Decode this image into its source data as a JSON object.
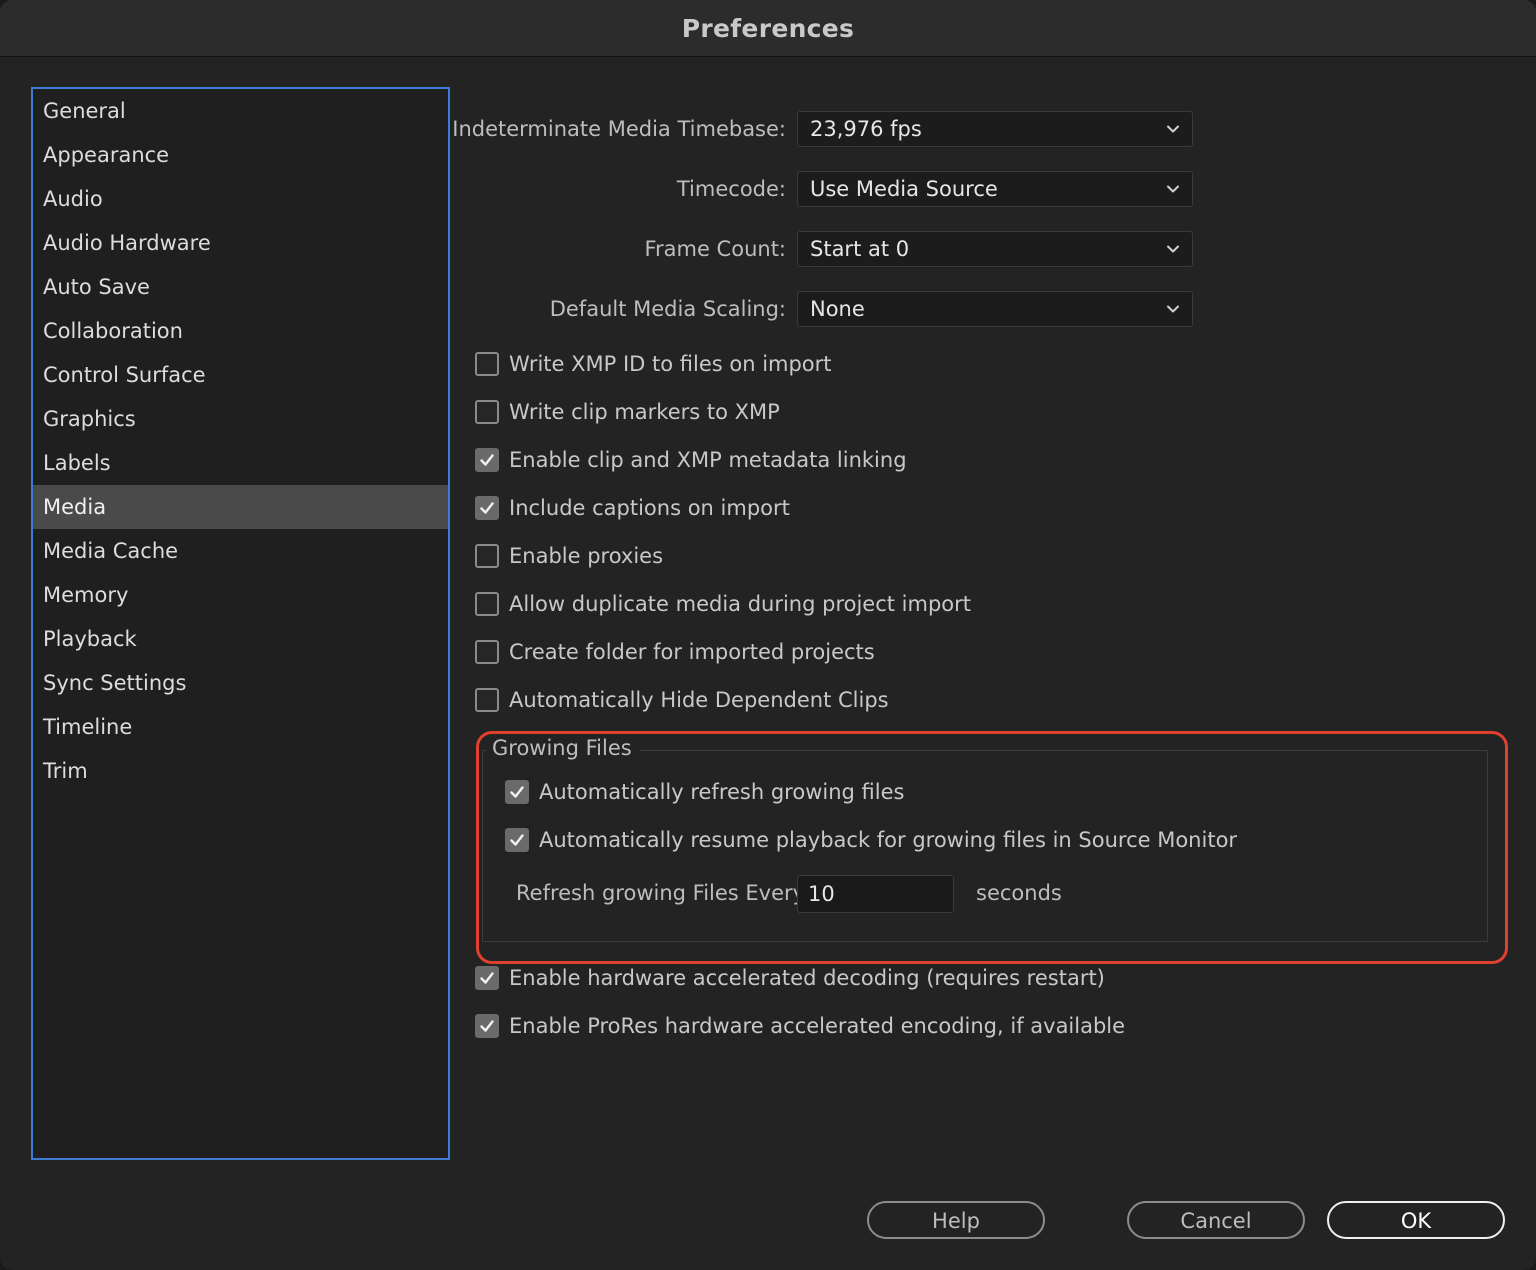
{
  "window": {
    "title": "Preferences"
  },
  "sidebar": {
    "items": [
      {
        "label": "General",
        "selected": false
      },
      {
        "label": "Appearance",
        "selected": false
      },
      {
        "label": "Audio",
        "selected": false
      },
      {
        "label": "Audio Hardware",
        "selected": false
      },
      {
        "label": "Auto Save",
        "selected": false
      },
      {
        "label": "Collaboration",
        "selected": false
      },
      {
        "label": "Control Surface",
        "selected": false
      },
      {
        "label": "Graphics",
        "selected": false
      },
      {
        "label": "Labels",
        "selected": false
      },
      {
        "label": "Media",
        "selected": true
      },
      {
        "label": "Media Cache",
        "selected": false
      },
      {
        "label": "Memory",
        "selected": false
      },
      {
        "label": "Playback",
        "selected": false
      },
      {
        "label": "Sync Settings",
        "selected": false
      },
      {
        "label": "Timeline",
        "selected": false
      },
      {
        "label": "Trim",
        "selected": false
      }
    ]
  },
  "media": {
    "timebase": {
      "label": "Indeterminate Media Timebase:",
      "value": "23,976 fps"
    },
    "timecode": {
      "label": "Timecode:",
      "value": "Use Media Source"
    },
    "frame_count": {
      "label": "Frame Count:",
      "value": "Start at 0"
    },
    "scaling": {
      "label": "Default Media Scaling:",
      "value": "None"
    },
    "options": [
      {
        "label": "Write XMP ID to files on import",
        "checked": false
      },
      {
        "label": "Write clip markers to XMP",
        "checked": false
      },
      {
        "label": "Enable clip and XMP metadata linking",
        "checked": true
      },
      {
        "label": "Include captions on import",
        "checked": true
      },
      {
        "label": "Enable proxies",
        "checked": false
      },
      {
        "label": "Allow duplicate media during project import",
        "checked": false
      },
      {
        "label": "Create folder for imported projects",
        "checked": false
      },
      {
        "label": "Automatically Hide Dependent Clips",
        "checked": false
      }
    ],
    "growing_files": {
      "title": "Growing Files",
      "auto_refresh": {
        "label": "Automatically refresh growing files",
        "checked": true
      },
      "auto_resume": {
        "label": "Automatically resume playback for growing files in Source Monitor",
        "checked": true
      },
      "refresh_label": "Refresh growing Files Every",
      "refresh_value": "10",
      "refresh_unit": "seconds"
    },
    "hw_decode": {
      "label": "Enable hardware accelerated decoding (requires restart)",
      "checked": true
    },
    "prores_encode": {
      "label": "Enable ProRes hardware accelerated encoding, if available",
      "checked": true
    }
  },
  "buttons": {
    "help": "Help",
    "cancel": "Cancel",
    "ok": "OK"
  },
  "colors": {
    "accent": "#3d7bd4",
    "highlight": "#e0402e",
    "background": "#232323"
  }
}
